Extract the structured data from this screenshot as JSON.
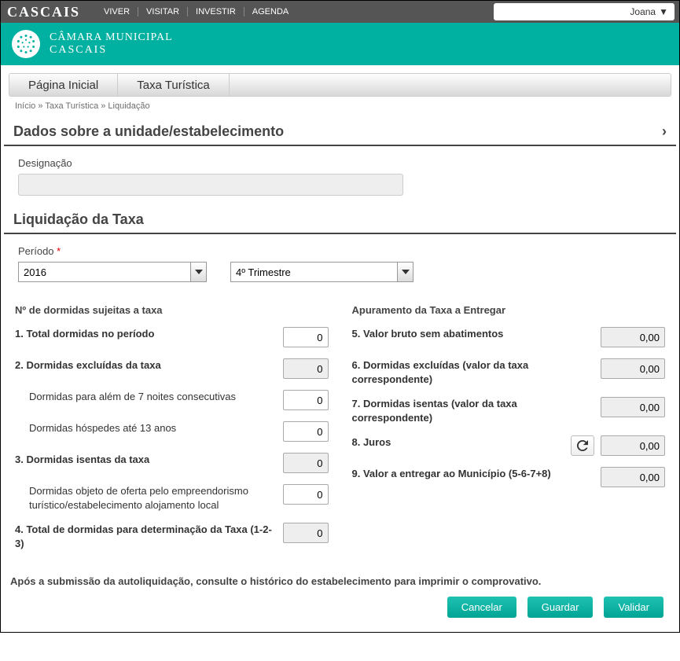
{
  "topbar": {
    "brand": "CASCAIS",
    "nav": [
      "VIVER",
      "VISITAR",
      "INVESTIR",
      "AGENDA"
    ],
    "user": "Joana"
  },
  "brandbar": {
    "line1": "CÂMARA MUNICIPAL",
    "line2": "CASCAIS"
  },
  "tabs": {
    "home": "Página Inicial",
    "taxa": "Taxa Turística"
  },
  "breadcrumb": "Início » Taxa Turística » Liquidação",
  "sections": {
    "estab_title": "Dados sobre a unidade/estabelecimento",
    "liquid_title": "Liquidação da Taxa"
  },
  "estab": {
    "designacao_label": "Designação",
    "designacao_value": ""
  },
  "periodo": {
    "label": "Período",
    "year": "2016",
    "quarter": "4º Trimestre"
  },
  "left": {
    "title": "Nº de dormidas sujeitas a taxa",
    "r1_label": "1. Total dormidas no período",
    "r1_value": "0",
    "r2_label": "2. Dormidas excluídas da taxa",
    "r2_value": "0",
    "r2a_label": "Dormidas para além de 7 noites consecutivas",
    "r2a_value": "0",
    "r2b_label": "Dormidas hóspedes até 13 anos",
    "r2b_value": "0",
    "r3_label": "3. Dormidas isentas da taxa",
    "r3_value": "0",
    "r3a_label": "Dormidas objeto de oferta pelo empreendorismo turístico/estabelecimento alojamento local",
    "r3a_value": "0",
    "r4_label": "4. Total de dormidas para determinação da Taxa (1-2-3)",
    "r4_value": "0"
  },
  "right": {
    "title": "Apuramento da Taxa a Entregar",
    "r5_label": "5. Valor bruto sem abatimentos",
    "r5_value": "0,00",
    "r6_label": "6. Dormidas excluídas (valor da taxa correspondente)",
    "r6_value": "0,00",
    "r7_label": "7. Dormidas isentas (valor da taxa correspondente)",
    "r7_value": "0,00",
    "r8_label": "8. Juros",
    "r8_value": "0,00",
    "r9_label": "9. Valor a entregar ao Município (5-6-7+8)",
    "r9_value": "0,00"
  },
  "note": "Após a submissão da autoliquidação, consulte o histórico do estabelecimento para imprimir o comprovativo.",
  "actions": {
    "cancel": "Cancelar",
    "save": "Guardar",
    "validate": "Validar"
  }
}
